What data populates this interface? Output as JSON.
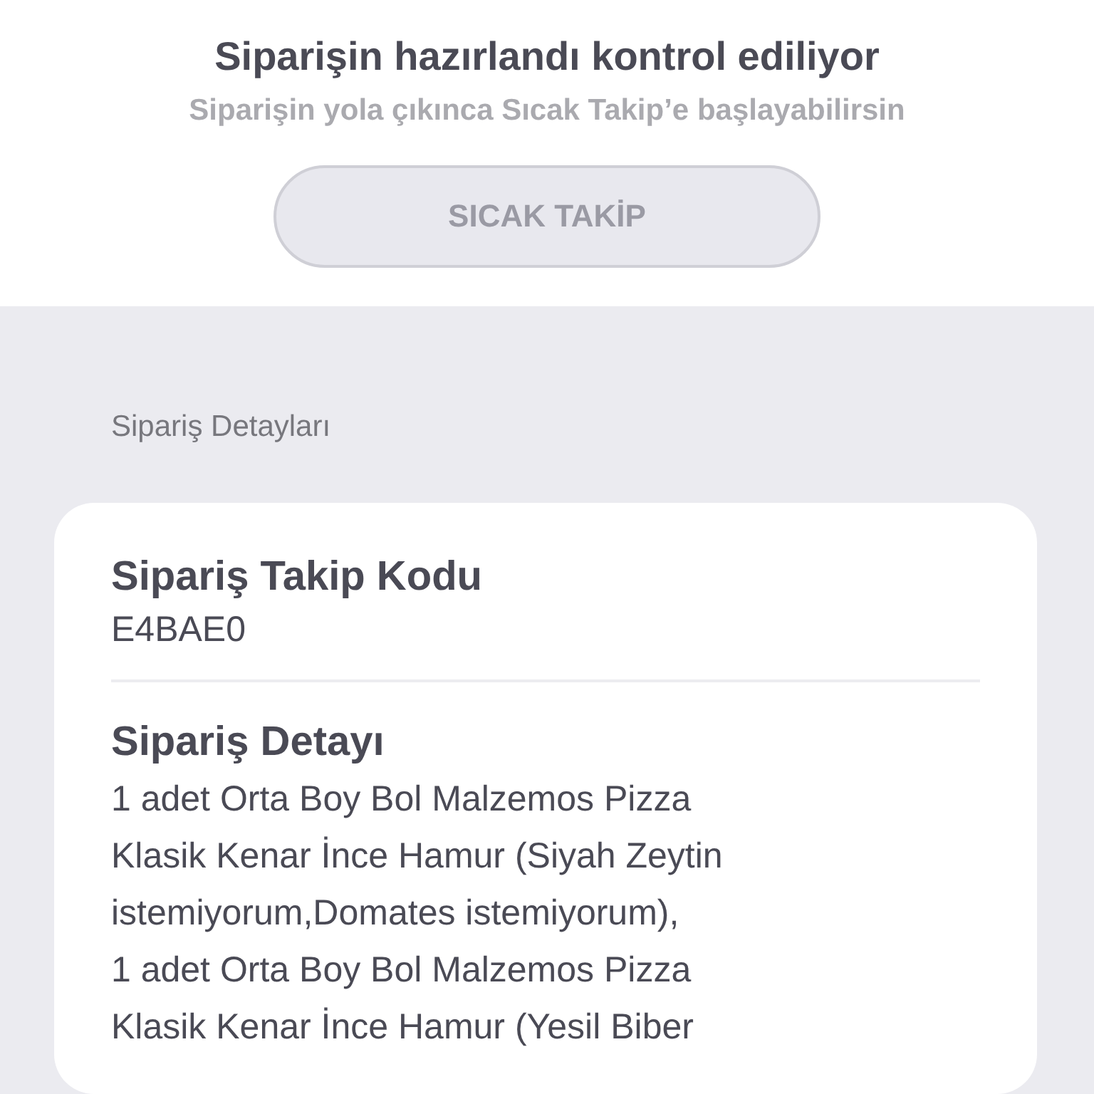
{
  "header": {
    "title": "Siparişin hazırlandı kontrol ediliyor",
    "subtitle": "Siparişin yola çıkınca Sıcak Takip’e başlayabilirsin",
    "button": {
      "label": "SICAK TAKİP",
      "disabled": true
    }
  },
  "section_title": "Sipariş Detayları",
  "card": {
    "fields": [
      {
        "label": "Sipariş Takip Kodu",
        "lines": [
          "E4BAE0"
        ]
      },
      {
        "label": "Sipariş Detayı",
        "lines": [
          "1 adet Orta Boy Bol Malzemos Pizza",
          "Klasik Kenar İnce Hamur (Siyah Zeytin",
          "istemiyorum,Domates istemiyorum),",
          "1 adet Orta Boy Bol Malzemos Pizza",
          "Klasik Kenar İnce Hamur (Yesil Biber"
        ]
      }
    ]
  }
}
